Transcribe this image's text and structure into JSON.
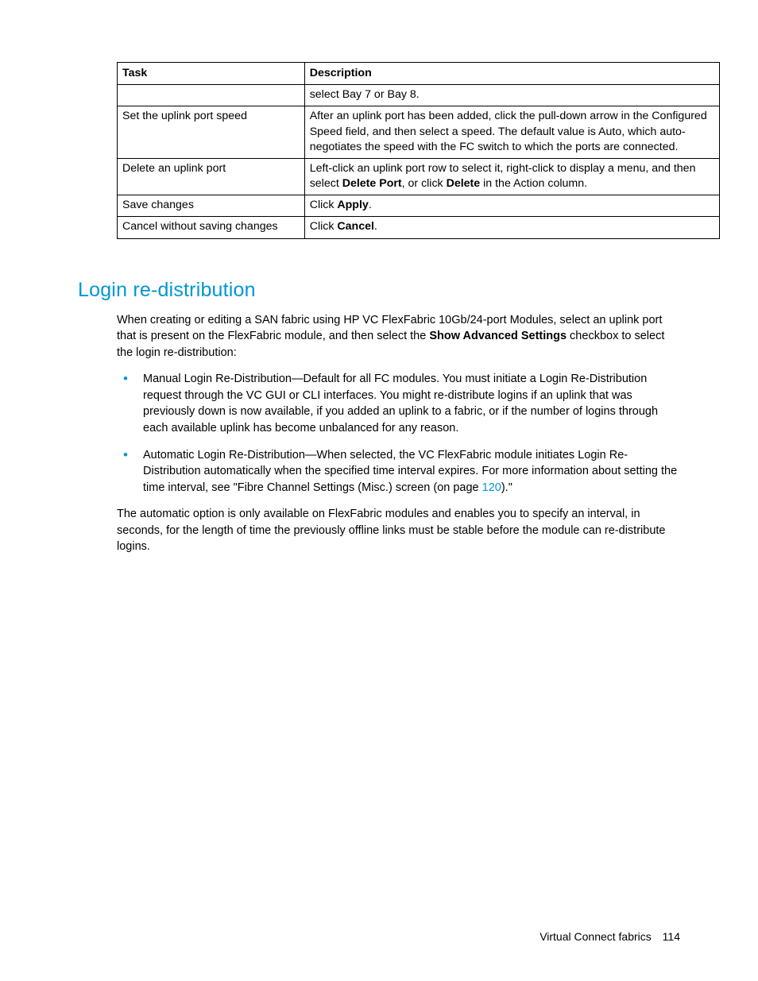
{
  "table": {
    "headers": {
      "task": "Task",
      "description": "Description"
    },
    "rows": [
      {
        "task": "",
        "desc_plain": "select Bay 7 or Bay 8."
      },
      {
        "task": "Set the uplink port speed",
        "desc_plain": "After an uplink port has been added, click the pull-down arrow in the Configured Speed field, and then select a speed. The default value is Auto, which auto-negotiates the speed with the FC switch to which the ports are connected."
      },
      {
        "task": "Delete an uplink port",
        "desc_pre": "Left-click an uplink port row to select it, right-click to display a menu, and then select ",
        "desc_bold1": "Delete Port",
        "desc_mid": ", or click ",
        "desc_bold2": "Delete",
        "desc_post": " in the Action column."
      },
      {
        "task": "Save changes",
        "desc_pre": "Click ",
        "desc_bold1": "Apply",
        "desc_post": "."
      },
      {
        "task": "Cancel without saving changes",
        "desc_pre": "Click ",
        "desc_bold1": "Cancel",
        "desc_post": "."
      }
    ]
  },
  "section": {
    "title": "Login re-distribution",
    "intro_pre": "When creating or editing a SAN fabric using HP VC FlexFabric 10Gb/24-port Modules, select an uplink port that is present on the FlexFabric module, and then select the ",
    "intro_bold": "Show Advanced Settings",
    "intro_post": " checkbox to select the login re-distribution:",
    "bullets": [
      {
        "text": "Manual Login Re-Distribution—Default for all FC modules. You must initiate a Login Re-Distribution request through the VC GUI or CLI interfaces. You might re-distribute logins if an uplink that was previously down is now available, if you added an uplink to a fabric, or if the number of logins through each available uplink has become unbalanced for any reason."
      },
      {
        "text_pre": "Automatic Login Re-Distribution—When selected, the VC FlexFabric module initiates Login Re-Distribution automatically when the specified time interval expires. For more information about setting the time interval, see \"Fibre Channel Settings (Misc.) screen (on page ",
        "link": "120",
        "text_post": ").\""
      }
    ],
    "outro": "The automatic option is only available on FlexFabric modules and enables you to specify an interval, in seconds, for the length of time the previously offline links must be stable before the module can re-distribute logins."
  },
  "footer": {
    "section_name": "Virtual Connect fabrics",
    "page_number": "114"
  }
}
